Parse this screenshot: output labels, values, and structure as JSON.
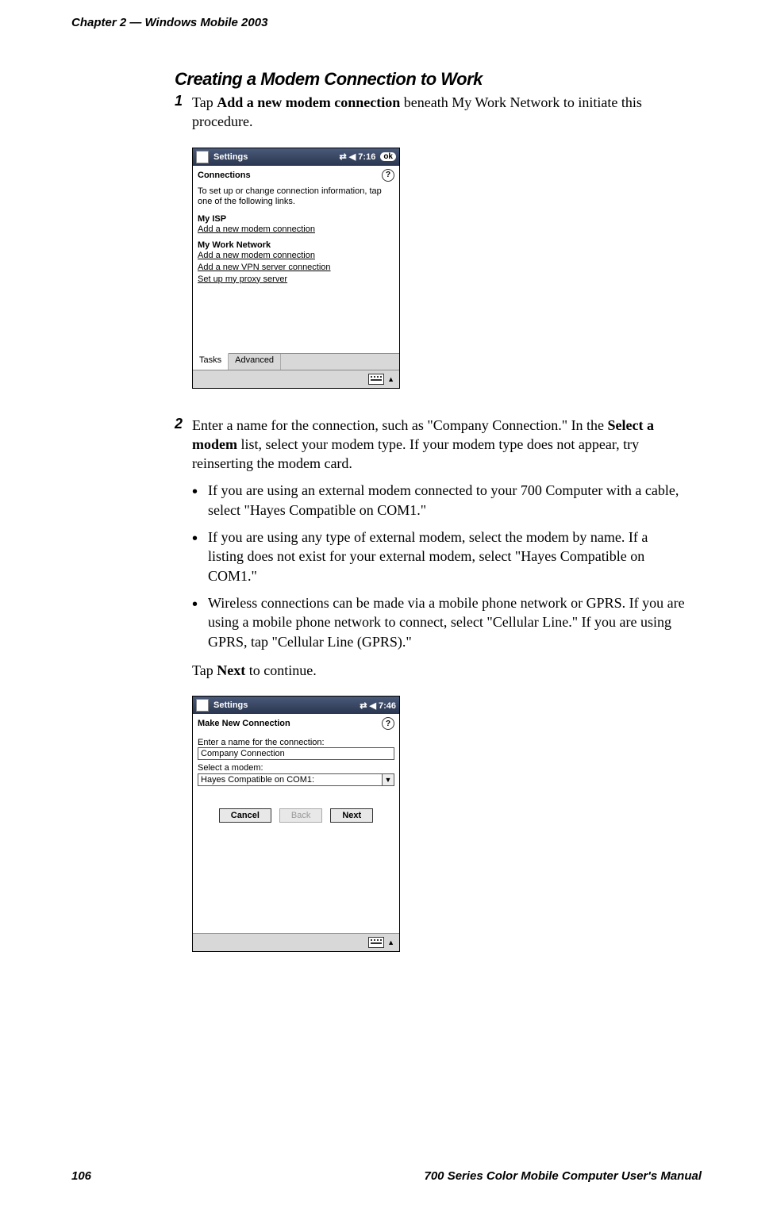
{
  "running_head": {
    "left": "Chapter 2   —   Windows Mobile 2003"
  },
  "heading": "Creating a Modem Connection to Work",
  "step1": {
    "num": "1",
    "pre": "Tap ",
    "bold": "Add a new modem connection",
    "post": " beneath My Work Network to initiate this procedure."
  },
  "shot1": {
    "title": "Settings",
    "icons": "⇄  ◀ 7:16",
    "ok": "ok",
    "header": "Connections",
    "blurb": "To set up or change connection information, tap one of the following links.",
    "isp_title": "My ISP",
    "isp_link1": "Add a new modem connection",
    "work_title": "My Work Network",
    "work_link1": "Add a new modem connection",
    "work_link2": "Add a new VPN server connection",
    "work_link3": "Set up my proxy server",
    "tab_tasks": "Tasks",
    "tab_advanced": "Advanced"
  },
  "step2": {
    "num": "2",
    "line1_pre": "Enter a name for the connection, such as \"Company Connection.\" In the ",
    "line1_bold": "Select a modem",
    "line1_post": " list, select your modem type. If your modem type does not appear, try reinserting the modem card.",
    "bullet1": "If you are using an external modem connected to your 700 Computer with a cable, select \"Hayes Compatible on COM1.\"",
    "bullet2": "If you are using any type of external modem, select the modem by name. If a listing does not exist for your external modem, select \"Hayes Compatible on COM1.\"",
    "bullet3": "Wireless connections can be made via a mobile phone network or GPRS. If you are using a mobile phone network to connect, select \"Cellular Line.\" If you are using GPRS, tap \"Cellular Line (GPRS).\"",
    "tap_next_pre": "Tap ",
    "tap_next_bold": "Next",
    "tap_next_post": " to continue."
  },
  "shot2": {
    "title": "Settings",
    "icons": "⇄  ◀ 7:46",
    "header": "Make New Connection",
    "label_name": "Enter a name for the connection:",
    "name_value": "Company Connection",
    "label_modem": "Select a modem:",
    "modem_value": "Hayes Compatible on COM1:",
    "btn_cancel": "Cancel",
    "btn_back": "Back",
    "btn_next": "Next"
  },
  "footer": {
    "page": "106",
    "title": "700 Series Color Mobile Computer User's Manual"
  }
}
